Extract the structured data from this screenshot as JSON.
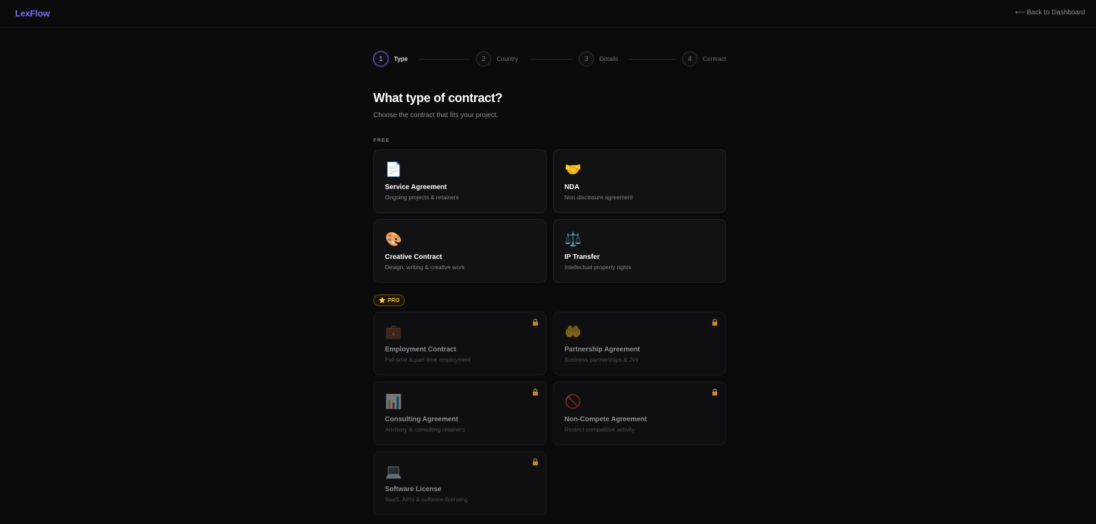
{
  "header": {
    "logo": "LexFlow",
    "back_link": "⟵ Back to Dashboard"
  },
  "stepper": {
    "steps": [
      {
        "number": "1",
        "label": "Type",
        "active": true
      },
      {
        "number": "2",
        "label": "Country",
        "active": false
      },
      {
        "number": "3",
        "label": "Details",
        "active": false
      },
      {
        "number": "4",
        "label": "Contract",
        "active": false
      }
    ]
  },
  "main": {
    "title": "What type of contract?",
    "subtitle": "Choose the contract that fits your project."
  },
  "free_section": {
    "label": "FREE",
    "cards": [
      {
        "icon": "📄",
        "icon_name": "document-icon",
        "title": "Service Agreement",
        "desc": "Ongoing projects & retainers"
      },
      {
        "icon": "🤝",
        "icon_name": "handshake-icon",
        "title": "NDA",
        "desc": "Non-disclosure agreement"
      },
      {
        "icon": "🎨",
        "icon_name": "palette-icon",
        "title": "Creative Contract",
        "desc": "Design, writing & creative work"
      },
      {
        "icon": "⚖️",
        "icon_name": "scales-icon",
        "title": "IP Transfer",
        "desc": "Intellectual property rights"
      }
    ]
  },
  "pro_section": {
    "badge_star": "⭐",
    "badge_label": "PRO",
    "cards": [
      {
        "icon": "💼",
        "icon_name": "briefcase-icon",
        "title": "Employment Contract",
        "desc": "Full-time & part-time employment"
      },
      {
        "icon": "🤲",
        "icon_name": "open-hands-icon",
        "title": "Partnership Agreement",
        "desc": "Business partnerships & JVs"
      },
      {
        "icon": "📊",
        "icon_name": "bar-chart-icon",
        "title": "Consulting Agreement",
        "desc": "Advisory & consulting retainers"
      },
      {
        "icon": "🚫",
        "icon_name": "prohibited-icon",
        "title": "Non-Compete Agreement",
        "desc": "Restrict competitive activity"
      },
      {
        "icon": "💻",
        "icon_name": "laptop-icon",
        "title": "Software License",
        "desc": "SaaS, APIs & software licensing"
      }
    ]
  },
  "colors": {
    "accent": "#7b6cf6",
    "pro_gold": "#f1b62f",
    "lock": "#c58a2e",
    "background": "#0b0b0c"
  }
}
